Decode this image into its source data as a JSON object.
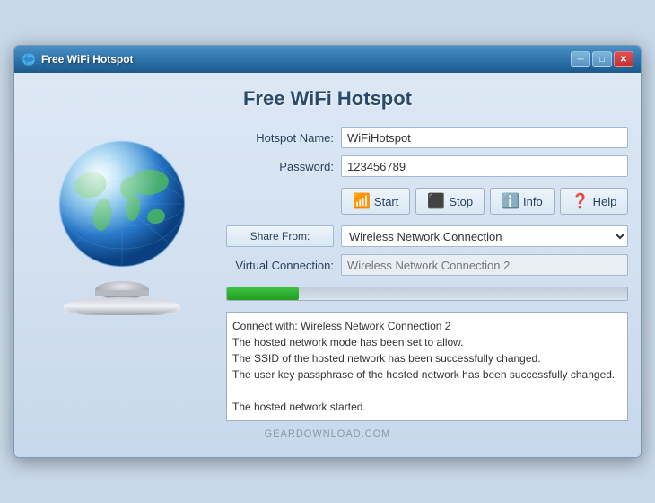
{
  "titleBar": {
    "title": "Free WiFi Hotspot",
    "icon": "wifi"
  },
  "appTitle": "Free WiFi Hotspot",
  "form": {
    "hotspotNameLabel": "Hotspot Name:",
    "hotspotNameValue": "WiFiHotspot",
    "passwordLabel": "Password:",
    "passwordValue": "123456789",
    "shareFromLabel": "Share From:",
    "shareFromValue": "Wireless Network Connection",
    "virtualConnectionLabel": "Virtual Connection:",
    "virtualConnectionPlaceholder": "Wireless Network Connection 2"
  },
  "buttons": {
    "start": "Start",
    "stop": "Stop",
    "info": "Info",
    "help": "Help"
  },
  "progressBar": {
    "percent": 18
  },
  "log": {
    "lines": [
      "Connect with: Wireless Network Connection 2",
      "The hosted network mode has been set to allow.",
      "The SSID of the hosted network has been successfully changed.",
      "The user key passphrase of the hosted network has been successfully changed.",
      "",
      "The hosted network started."
    ]
  },
  "watermark": "GEARDOWNLOAD.COM"
}
